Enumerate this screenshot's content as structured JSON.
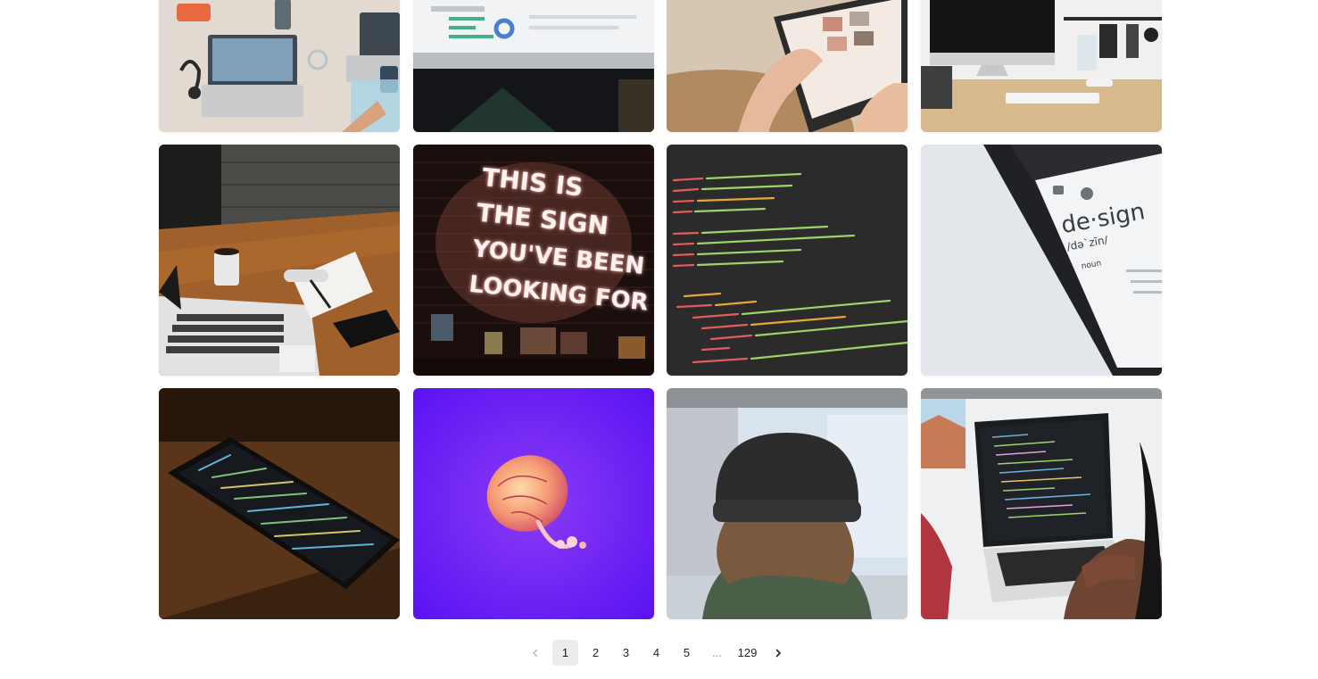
{
  "gallery": {
    "images": [
      {
        "name": "desk-laptop-headphones-image"
      },
      {
        "name": "laptop-dashboard-image"
      },
      {
        "name": "tablet-touch-image"
      },
      {
        "name": "imac-desk-image"
      },
      {
        "name": "coffee-laptop-notes-image"
      },
      {
        "name": "neon-sign-image",
        "overlay_text": [
          "THIS IS",
          "THE SIGN",
          "YOU'VE BEEN",
          "LOOKING FOR"
        ]
      },
      {
        "name": "html-code-image"
      },
      {
        "name": "design-definition-image",
        "overlay_text": [
          "de·sign",
          "/də`zīn/",
          "noun"
        ]
      },
      {
        "name": "phone-code-image"
      },
      {
        "name": "jellyfish-image"
      },
      {
        "name": "beanie-developer-image"
      },
      {
        "name": "laptop-coding-image"
      }
    ]
  },
  "pagination": {
    "prev_icon": "chevron-left-icon",
    "next_icon": "chevron-right-icon",
    "pages": [
      "1",
      "2",
      "3",
      "4",
      "5"
    ],
    "ellipsis": "...",
    "last_page": "129",
    "current": "1"
  },
  "colors": {
    "active_page_bg": "#ececec",
    "text": "#222222",
    "disabled": "#b5b5b5"
  }
}
